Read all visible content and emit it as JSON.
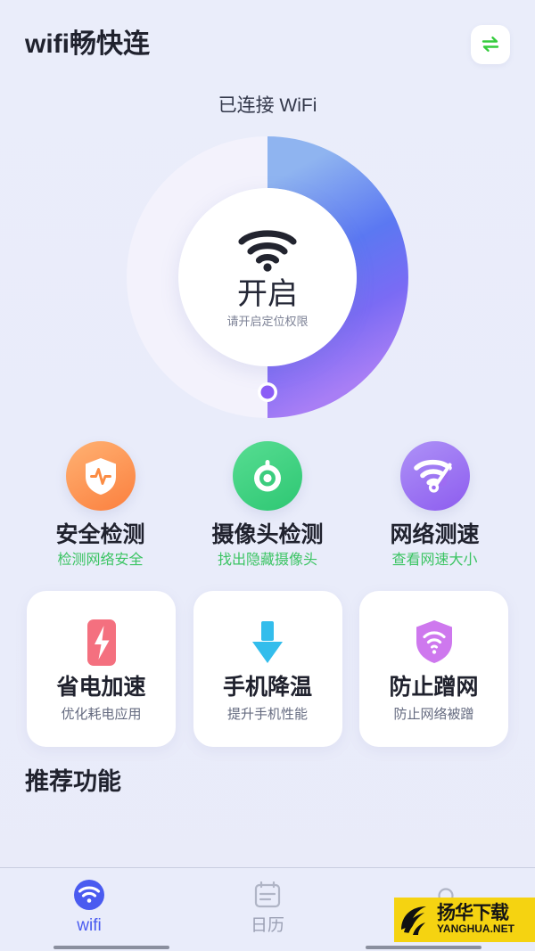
{
  "header": {
    "app_title": "wifi畅快连",
    "switch_icon": "exchange-arrows-icon",
    "switch_icon_color": "#35cc3d"
  },
  "status": {
    "connected_label": "已连接 WiFi"
  },
  "gauge": {
    "center_icon": "wifi-icon",
    "main_label": "开启",
    "sub_label": "请开启定位权限",
    "progress_percent": 50,
    "track_color": "#f3f2fc",
    "gradient_start": "#8fb4f0",
    "gradient_mid": "#5b78f2",
    "gradient_end": "#a07bf3",
    "handle_color": "#8b5cf6"
  },
  "features": [
    {
      "icon": "shield-pulse-icon",
      "title": "安全检测",
      "subtitle": "检测网络安全",
      "color_start": "#ffb273",
      "color_end": "#fb7f3e"
    },
    {
      "icon": "camera-lens-icon",
      "title": "摄像头检测",
      "subtitle": "找出隐藏摄像头",
      "color_start": "#57dd92",
      "color_end": "#2ec773"
    },
    {
      "icon": "wifi-speedometer-icon",
      "title": "网络测速",
      "subtitle": "查看网速大小",
      "color_start": "#ae92f7",
      "color_end": "#8d5cef"
    }
  ],
  "cards": [
    {
      "icon": "battery-bolt-icon",
      "title": "省电加速",
      "subtitle": "优化耗电应用",
      "color": "#f4707f"
    },
    {
      "icon": "down-arrow-cool-icon",
      "title": "手机降温",
      "subtitle": "提升手机性能",
      "color": "#33bdec"
    },
    {
      "icon": "shield-wifi-icon",
      "title": "防止蹭网",
      "subtitle": "防止网络被蹭",
      "color": "#ce78ee"
    }
  ],
  "recommend": {
    "section_title": "推荐功能"
  },
  "bottom_nav": {
    "active_color": "#4a5bf0",
    "inactive_color": "#9ba0b4",
    "items": [
      {
        "icon": "wifi-filled-icon",
        "label": "wifi",
        "active": true
      },
      {
        "icon": "calendar-icon",
        "label": "日历",
        "active": false
      },
      {
        "icon": "person-icon",
        "label": "",
        "active": false
      }
    ]
  },
  "watermark": {
    "cn_text": "扬华下载",
    "en_text": "YANGHUA.NET",
    "background": "#f5d311"
  }
}
